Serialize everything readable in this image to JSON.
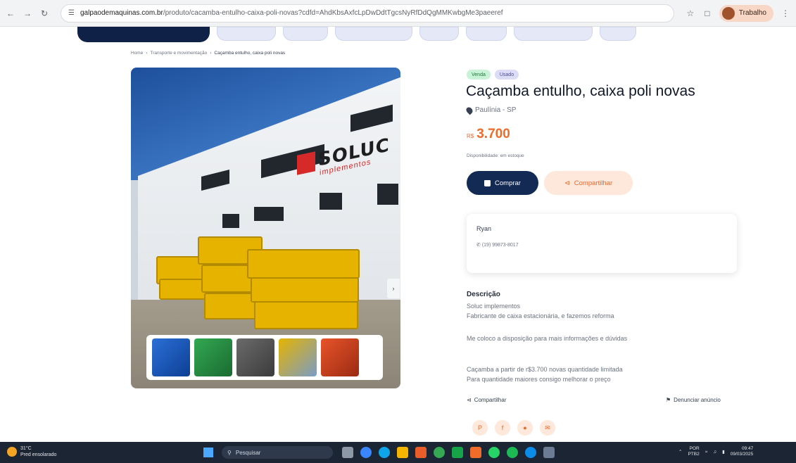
{
  "browser": {
    "url_host": "galpaodemaquinas.com.br",
    "url_path": "/produto/cacamba-entulho-caixa-poli-novas?cdfd=AhdKbsAxfcLpDwDdtTgcsNyRfDdQgMMKwbgMe3paeeref",
    "profile_label": "Trabalho"
  },
  "breadcrumb": {
    "items": [
      "Home",
      "Transporte e movimentação"
    ],
    "current": "Caçamba entulho, caixa poli novas"
  },
  "product": {
    "tags": [
      "Venda",
      "Usado"
    ],
    "title": "Caçamba entulho, caixa poli novas",
    "location": "Paulínia - SP",
    "price_currency": "R$",
    "price_value": "3.700",
    "availability": "Disponibilidade: em estoque",
    "buy_label": "Comprar",
    "share_label": "Compartilhar"
  },
  "image": {
    "logo_text": "SOLUC",
    "logo_sub": "implementos"
  },
  "seller": {
    "name": "Ryan",
    "phone": "(19) 99873-8017"
  },
  "description": {
    "heading": "Descrição",
    "lines": [
      "Soluc implementos",
      "Fabricante de caixa estacionária, e fazemos reforma",
      "Me coloco a disposição para mais informações e dúvidas",
      "Caçamba a partir de r$3.700 novas quantidade limitada",
      "Para quantidade maiores consigo melhorar o preço"
    ]
  },
  "footer_actions": {
    "share_label": "Compartilhar",
    "report_label": "Denunciar anúncio"
  },
  "taskbar": {
    "weather_temp": "31°C",
    "weather_desc": "Pred ensolarado",
    "search_placeholder": "Pesquisar",
    "lang_top": "POR",
    "lang_bottom": "PTB2",
    "time": "09:47",
    "date": "09/03/2025"
  },
  "colors": {
    "primary_navy": "#132a54",
    "accent_orange": "#f06a2a",
    "share_bg": "#fde8db"
  }
}
